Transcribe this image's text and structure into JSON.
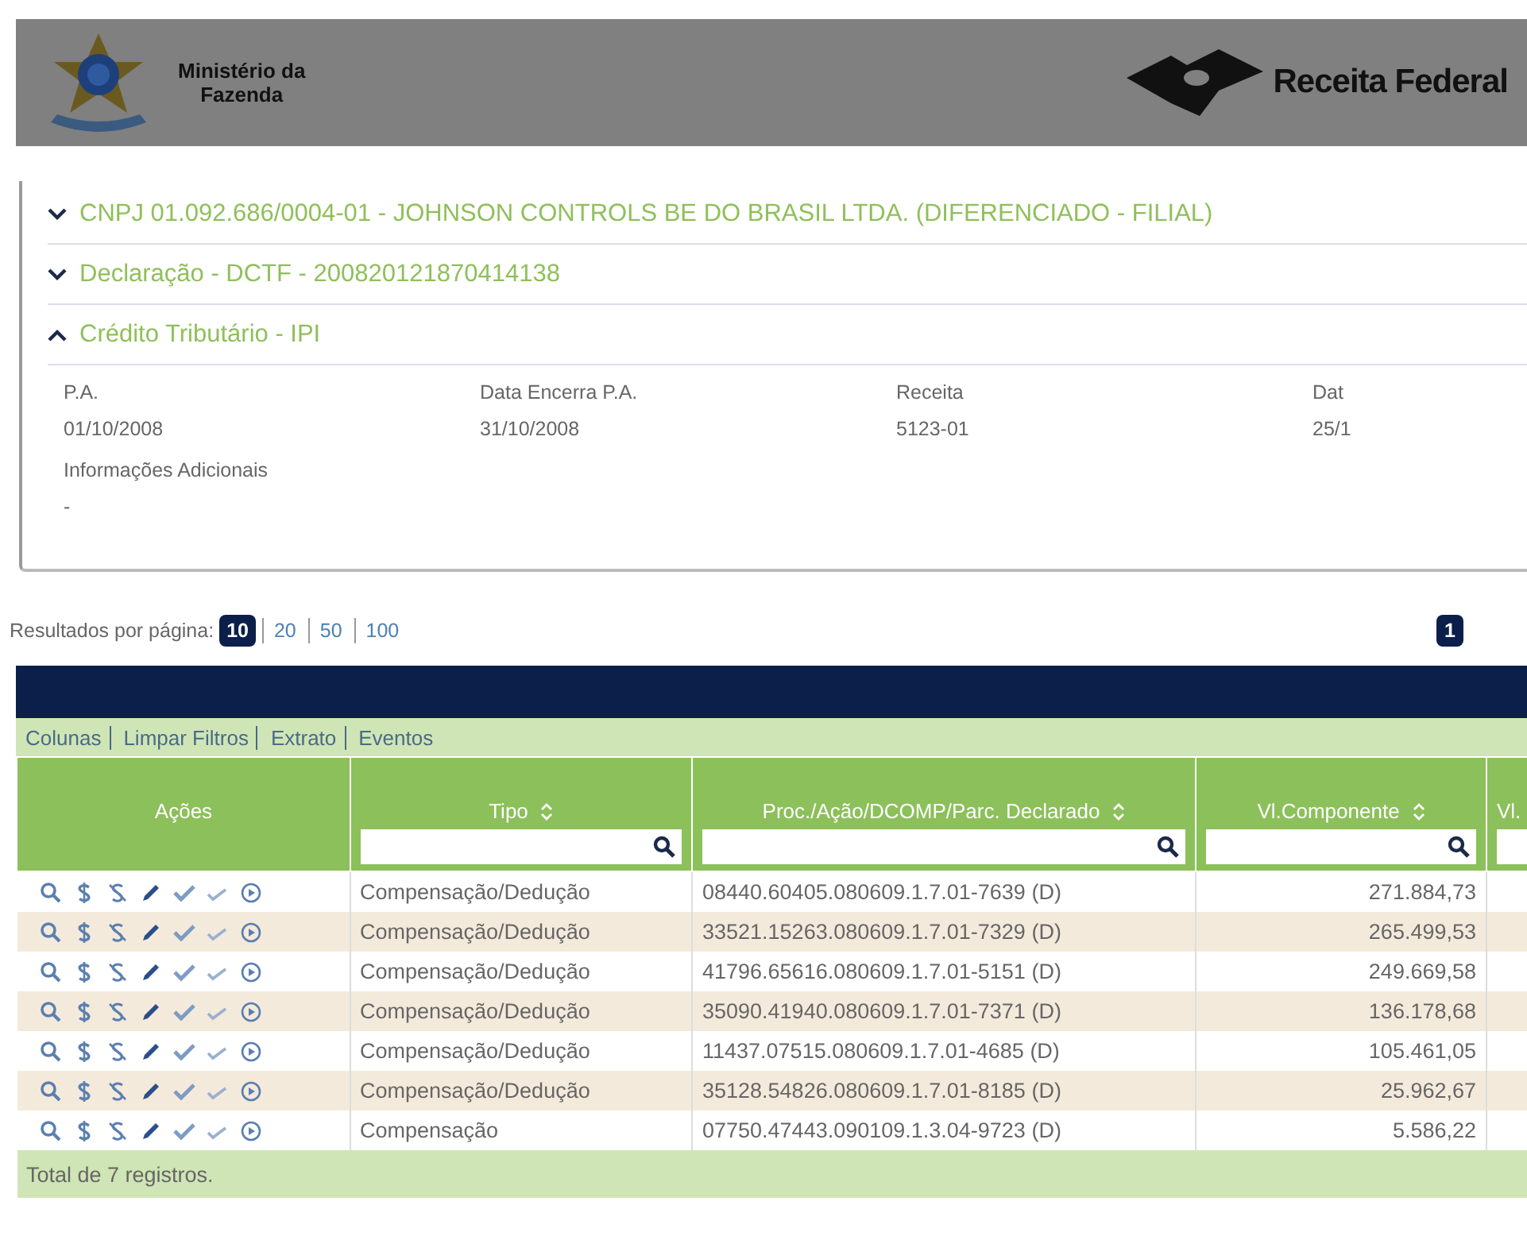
{
  "header": {
    "ministry_lines": [
      "Ministério da",
      "Fazenda"
    ],
    "brand": "Receita Federal"
  },
  "accordion": [
    {
      "title": "CNPJ 01.092.686/0004-01 - JOHNSON CONTROLS BE DO BRASIL LTDA. (DIFERENCIADO - FILIAL)",
      "expanded": false
    },
    {
      "title": "Declaração - DCTF - 200820121870414138",
      "expanded": false
    },
    {
      "title": "Crédito Tributário - IPI",
      "expanded": true
    }
  ],
  "details": {
    "fields": [
      {
        "label": "P.A.",
        "value": "01/10/2008"
      },
      {
        "label": "Data Encerra P.A.",
        "value": "31/10/2008"
      },
      {
        "label": "Receita",
        "value": "5123-01"
      },
      {
        "label": "Dat",
        "value": "25/1"
      }
    ],
    "extra": {
      "label": "Informações Adicionais",
      "value": "-"
    }
  },
  "pagination": {
    "label": "Resultados por página:",
    "sizes": [
      {
        "label": "10",
        "selected": true
      },
      {
        "label": "20",
        "selected": false
      },
      {
        "label": "50",
        "selected": false
      },
      {
        "label": "100",
        "selected": false
      }
    ],
    "pages": [
      {
        "label": "1",
        "selected": true
      }
    ]
  },
  "toolbar": [
    "Colunas",
    "Limpar Filtros",
    "Extrato",
    "Eventos"
  ],
  "table": {
    "columns": [
      {
        "label": "Ações",
        "sortable": false,
        "filter": false
      },
      {
        "label": "Tipo",
        "sortable": true,
        "filter": true
      },
      {
        "label": "Proc./Ação/DCOMP/Parc. Declarado",
        "sortable": true,
        "filter": true
      },
      {
        "label": "Vl.Componente",
        "sortable": true,
        "filter": true
      },
      {
        "label": "Vl.",
        "sortable": false,
        "filter": true
      }
    ],
    "rows": [
      {
        "tipo": "Compensação/Dedução",
        "proc": "08440.60405.080609.1.7.01-7639 (D)",
        "valor": "271.884,73"
      },
      {
        "tipo": "Compensação/Dedução",
        "proc": "33521.15263.080609.1.7.01-7329 (D)",
        "valor": "265.499,53"
      },
      {
        "tipo": "Compensação/Dedução",
        "proc": "41796.65616.080609.1.7.01-5151 (D)",
        "valor": "249.669,58"
      },
      {
        "tipo": "Compensação/Dedução",
        "proc": "35090.41940.080609.1.7.01-7371 (D)",
        "valor": "136.178,68"
      },
      {
        "tipo": "Compensação/Dedução",
        "proc": "11437.07515.080609.1.7.01-4685 (D)",
        "valor": "105.461,05"
      },
      {
        "tipo": "Compensação/Dedução",
        "proc": "35128.54826.080609.1.7.01-8185 (D)",
        "valor": "25.962,67"
      },
      {
        "tipo": "Compensação",
        "proc": "07750.47443.090109.1.3.04-9723 (D)",
        "valor": "5.586,22"
      }
    ],
    "footer": "Total de 7 registros."
  }
}
